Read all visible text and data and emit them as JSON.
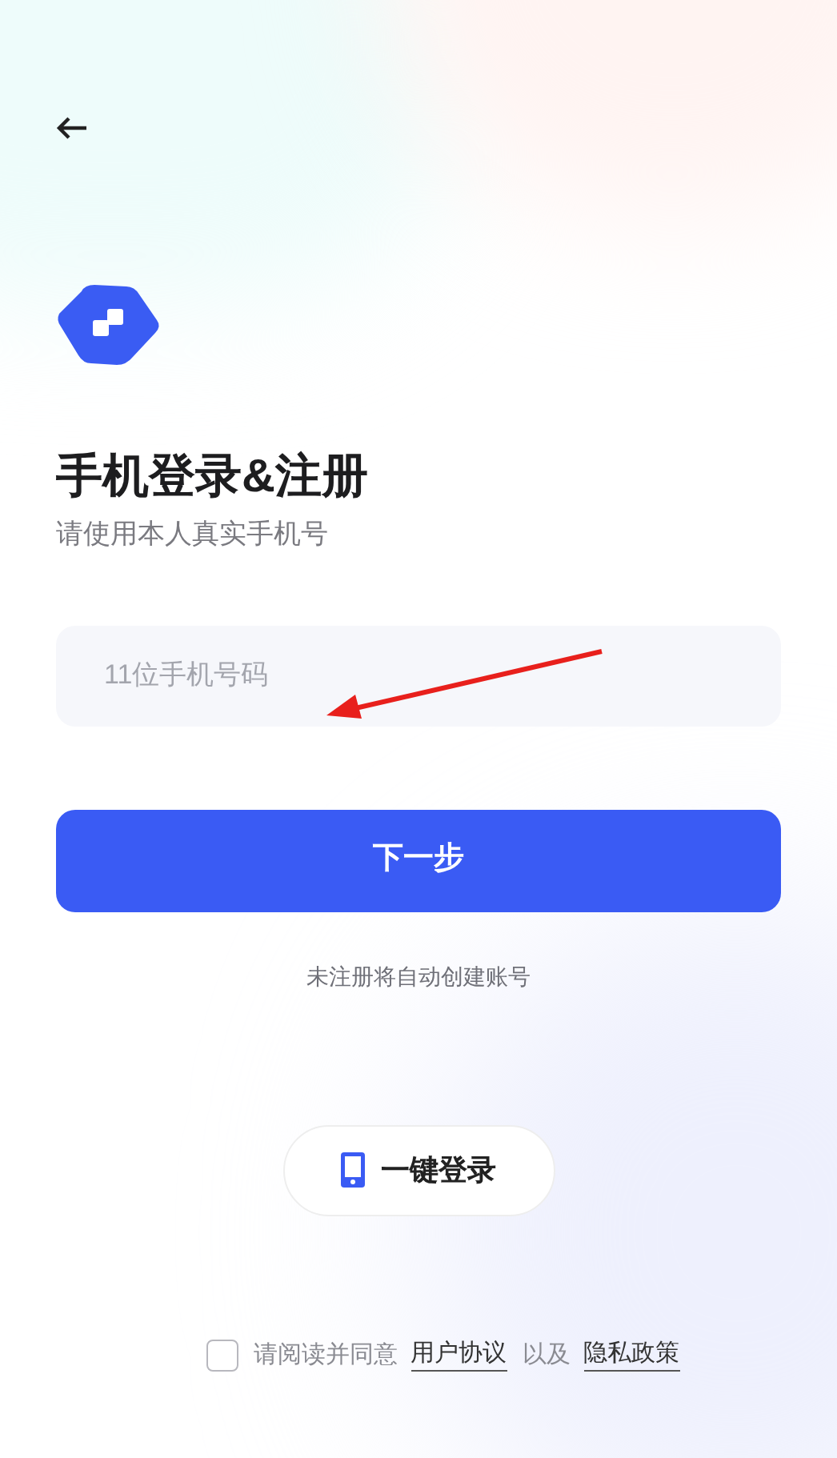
{
  "title": "手机登录&注册",
  "subtitle": "请使用本人真实手机号",
  "phone_field": {
    "placeholder": "11位手机号码"
  },
  "next_button": "下一步",
  "note": "未注册将自动创建账号",
  "one_click_button": "一键登录",
  "agreement": {
    "checked": false,
    "parts": [
      {
        "kind": "text",
        "text": "请阅读并同意"
      },
      {
        "kind": "link",
        "text": "用户协议"
      },
      {
        "kind": "text",
        "text": "以及"
      },
      {
        "kind": "link",
        "text": "隐私政策"
      }
    ]
  }
}
